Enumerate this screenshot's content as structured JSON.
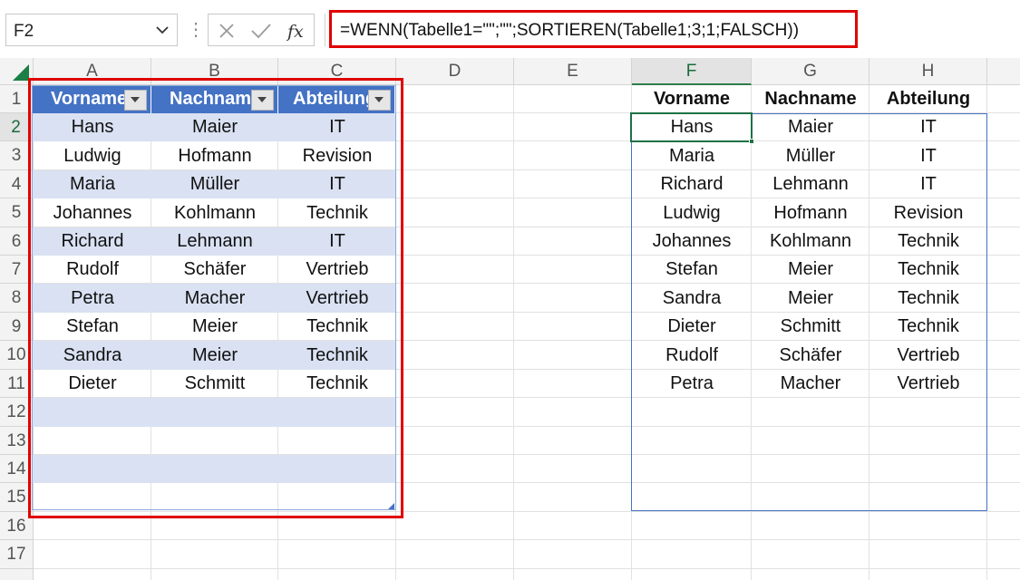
{
  "name_box": {
    "value": "F2"
  },
  "formula_bar": {
    "formula": "=WENN(Tabelle1=\"\";\"\";SORTIEREN(Tabelle1;3;1;FALSCH))"
  },
  "columns": [
    "A",
    "B",
    "C",
    "D",
    "E",
    "F",
    "G",
    "H"
  ],
  "rows": [
    "1",
    "2",
    "3",
    "4",
    "5",
    "6",
    "7",
    "8",
    "9",
    "10",
    "11",
    "12",
    "13",
    "14",
    "15",
    "16",
    "17"
  ],
  "source_table": {
    "headers": [
      "Vorname",
      "Nachname",
      "Abteilung"
    ],
    "rows": [
      [
        "Hans",
        "Maier",
        "IT"
      ],
      [
        "Ludwig",
        "Hofmann",
        "Revision"
      ],
      [
        "Maria",
        "Müller",
        "IT"
      ],
      [
        "Johannes",
        "Kohlmann",
        "Technik"
      ],
      [
        "Richard",
        "Lehmann",
        "IT"
      ],
      [
        "Rudolf",
        "Schäfer",
        "Vertrieb"
      ],
      [
        "Petra",
        "Macher",
        "Vertrieb"
      ],
      [
        "Stefan",
        "Meier",
        "Technik"
      ],
      [
        "Sandra",
        "Meier",
        "Technik"
      ],
      [
        "Dieter",
        "Schmitt",
        "Technik"
      ]
    ]
  },
  "result_table": {
    "headers": [
      "Vorname",
      "Nachname",
      "Abteilung"
    ],
    "rows": [
      [
        "Hans",
        "Maier",
        "IT"
      ],
      [
        "Maria",
        "Müller",
        "IT"
      ],
      [
        "Richard",
        "Lehmann",
        "IT"
      ],
      [
        "Ludwig",
        "Hofmann",
        "Revision"
      ],
      [
        "Johannes",
        "Kohlmann",
        "Technik"
      ],
      [
        "Stefan",
        "Meier",
        "Technik"
      ],
      [
        "Sandra",
        "Meier",
        "Technik"
      ],
      [
        "Dieter",
        "Schmitt",
        "Technik"
      ],
      [
        "Rudolf",
        "Schäfer",
        "Vertrieb"
      ],
      [
        "Petra",
        "Macher",
        "Vertrieb"
      ]
    ]
  },
  "colors": {
    "table_header": "#4472c4",
    "table_band": "#d9e1f2",
    "highlight": "#e00000",
    "selection": "#1e7145"
  }
}
